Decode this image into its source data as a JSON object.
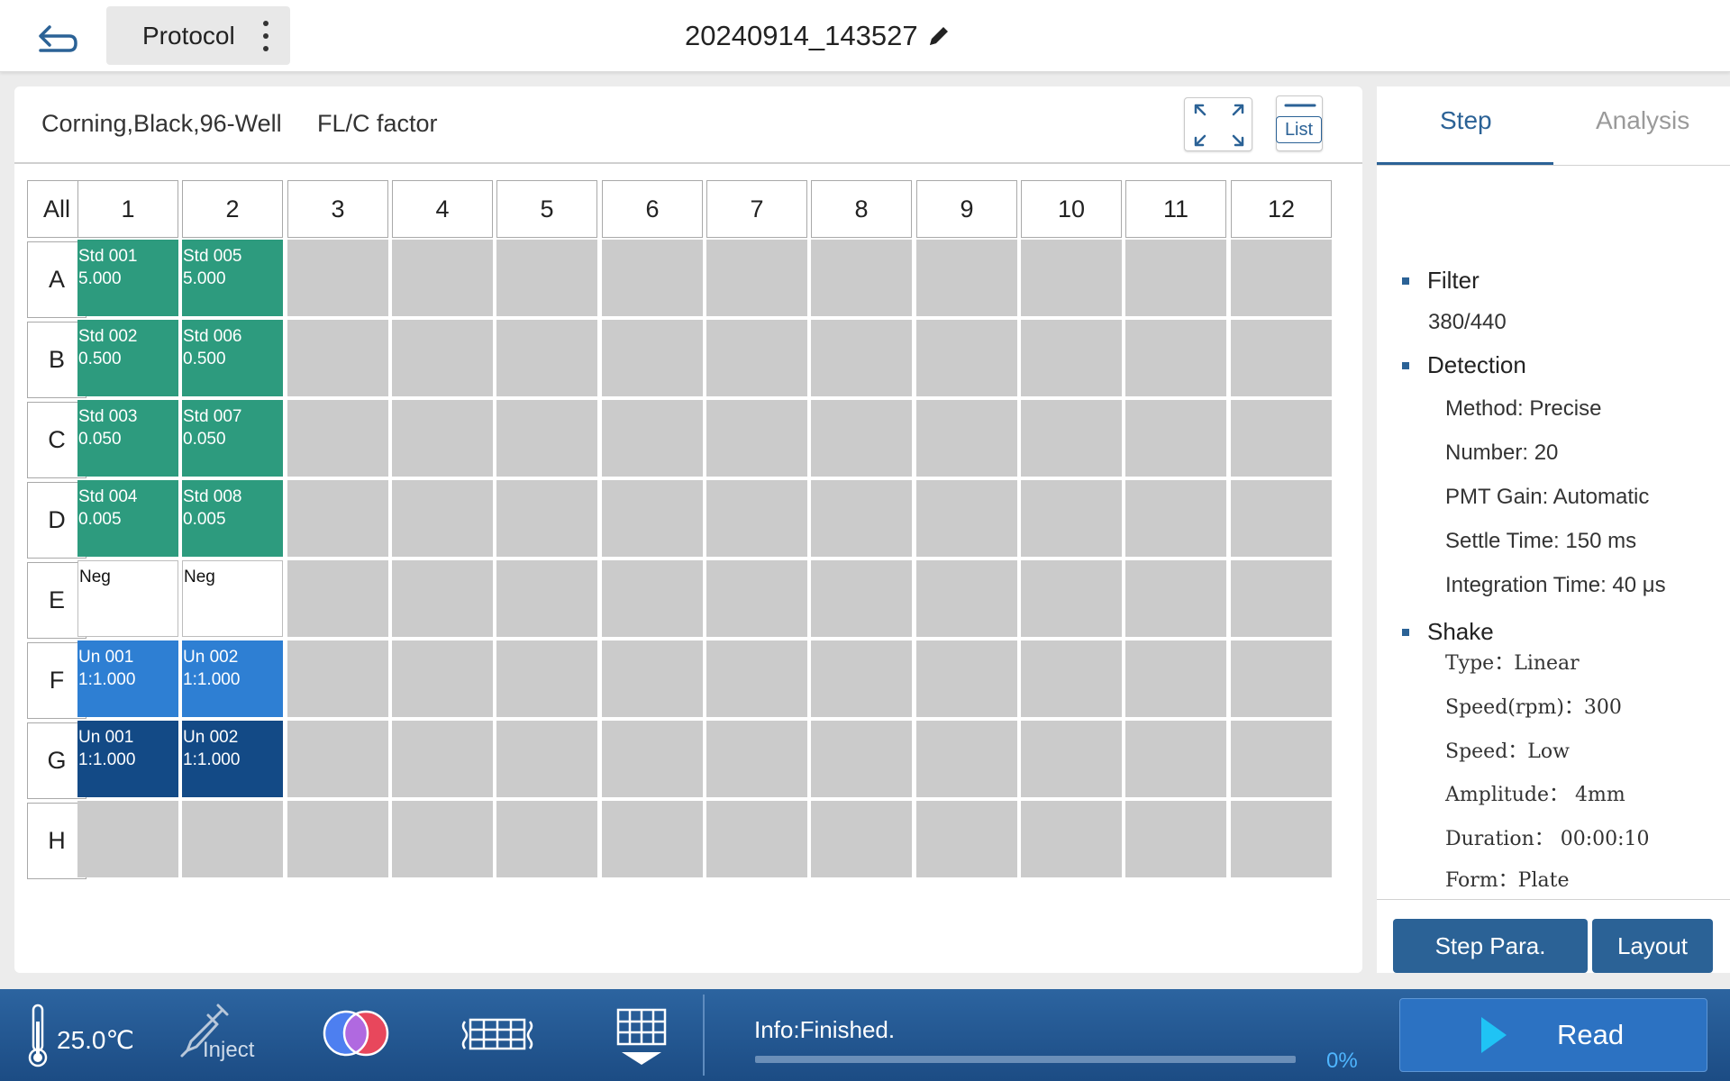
{
  "header": {
    "protocol_label": "Protocol",
    "title": "20240914_143527"
  },
  "plate": {
    "type": "Corning,Black,96-Well",
    "factor": "FL/C factor",
    "list_label": "List",
    "all_label": "All",
    "columns": [
      "1",
      "2",
      "3",
      "4",
      "5",
      "6",
      "7",
      "8",
      "9",
      "10",
      "11",
      "12"
    ],
    "rows": [
      "A",
      "B",
      "C",
      "D",
      "E",
      "F",
      "G",
      "H"
    ],
    "wells": {
      "A1": {
        "name": "Std 001",
        "value": "5.000",
        "kind": "std"
      },
      "B1": {
        "name": "Std 002",
        "value": "0.500",
        "kind": "std"
      },
      "C1": {
        "name": "Std 003",
        "value": "0.050",
        "kind": "std"
      },
      "D1": {
        "name": "Std 004",
        "value": "0.005",
        "kind": "std"
      },
      "E1": {
        "name": "Neg",
        "value": "",
        "kind": "neg"
      },
      "F1": {
        "name": "Un 001",
        "value": "1:1.000",
        "kind": "un-light"
      },
      "G1": {
        "name": "Un 001",
        "value": "1:1.000",
        "kind": "un-dark"
      },
      "A2": {
        "name": "Std 005",
        "value": "5.000",
        "kind": "std"
      },
      "B2": {
        "name": "Std 006",
        "value": "0.500",
        "kind": "std"
      },
      "C2": {
        "name": "Std 007",
        "value": "0.050",
        "kind": "std"
      },
      "D2": {
        "name": "Std 008",
        "value": "0.005",
        "kind": "std"
      },
      "E2": {
        "name": "Neg",
        "value": "",
        "kind": "neg"
      },
      "F2": {
        "name": "Un 002",
        "value": "1:1.000",
        "kind": "un-light"
      },
      "G2": {
        "name": "Un 002",
        "value": "1:1.000",
        "kind": "un-dark"
      }
    }
  },
  "tabs": {
    "step": "Step",
    "analysis": "Analysis"
  },
  "params": {
    "filter_title": "Filter",
    "filter_value": "380/440",
    "detection_title": "Detection",
    "method": "Method: Precise",
    "number": "Number: 20",
    "pmt_gain": "PMT Gain: Automatic",
    "settle_time": "Settle Time: 150 ms",
    "integration_time": "Integration Time: 40 μs",
    "shake_title": "Shake",
    "shake_type": "Type：Linear",
    "shake_speed_rpm": "Speed(rpm)：300",
    "shake_speed": "Speed：Low",
    "shake_amplitude": "Amplitude：  4mm",
    "shake_duration": "Duration：  00:00:10",
    "shake_form": "Form：Plate"
  },
  "buttons": {
    "step_para": "Step Para.",
    "layout": "Layout",
    "read": "Read"
  },
  "status": {
    "temperature": "25.0℃",
    "inject": "Inject",
    "info": "Info:Finished.",
    "progress_text": "0%",
    "progress_percent": 0
  },
  "colors": {
    "accent": "#2b6296",
    "std_well": "#2d9b7e",
    "unknown_light": "#2e7fd3",
    "unknown_dark": "#134a86",
    "empty_well": "#cbcbcb",
    "bottom_bar": "#2c64a0"
  },
  "icons": {
    "back": "back-arrow-icon",
    "edit": "pencil-icon",
    "expand": "expand-icon",
    "list": "list-icon",
    "temperature": "thermometer-icon",
    "inject": "pipette-icon",
    "filter": "filter-circles-icon",
    "plate": "plate-grid-icon",
    "layout": "layout-table-icon",
    "read": "play-icon"
  }
}
